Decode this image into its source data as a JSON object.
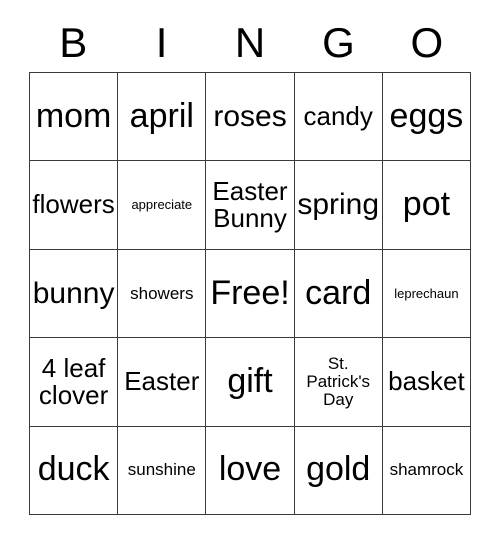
{
  "card": {
    "title": "BINGO",
    "header_letters": [
      "B",
      "I",
      "N",
      "G",
      "O"
    ],
    "free_space_label": "Free!",
    "colors": {
      "background": "#ffffff",
      "text": "#000000",
      "grid_line": "#3b3b3b"
    },
    "grid": {
      "columns": 5,
      "rows": 5,
      "cells": [
        [
          {
            "text": "mom",
            "size": "sz-xl"
          },
          {
            "text": "april",
            "size": "sz-xl"
          },
          {
            "text": "roses",
            "size": "sz-lg"
          },
          {
            "text": "candy",
            "size": "sz-md"
          },
          {
            "text": "eggs",
            "size": "sz-xl"
          }
        ],
        [
          {
            "text": "flowers",
            "size": "sz-md"
          },
          {
            "text": "appreciate",
            "size": "sz-xxs"
          },
          {
            "text": "Easter\nBunny",
            "size": "sz-md"
          },
          {
            "text": "spring",
            "size": "sz-lg"
          },
          {
            "text": "pot",
            "size": "sz-xl"
          }
        ],
        [
          {
            "text": "bunny",
            "size": "sz-lg"
          },
          {
            "text": "showers",
            "size": "sz-xs"
          },
          {
            "text": "Free!",
            "size": "sz-xl"
          },
          {
            "text": "card",
            "size": "sz-xl"
          },
          {
            "text": "leprechaun",
            "size": "sz-xxs"
          }
        ],
        [
          {
            "text": "4 leaf\nclover",
            "size": "sz-md"
          },
          {
            "text": "Easter",
            "size": "sz-md"
          },
          {
            "text": "gift",
            "size": "sz-xl"
          },
          {
            "text": "St.\nPatrick's\nDay",
            "size": "sz-xs"
          },
          {
            "text": "basket",
            "size": "sz-md"
          }
        ],
        [
          {
            "text": "duck",
            "size": "sz-xl"
          },
          {
            "text": "sunshine",
            "size": "sz-xs"
          },
          {
            "text": "love",
            "size": "sz-xl"
          },
          {
            "text": "gold",
            "size": "sz-xl"
          },
          {
            "text": "shamrock",
            "size": "sz-xs"
          }
        ]
      ]
    }
  }
}
